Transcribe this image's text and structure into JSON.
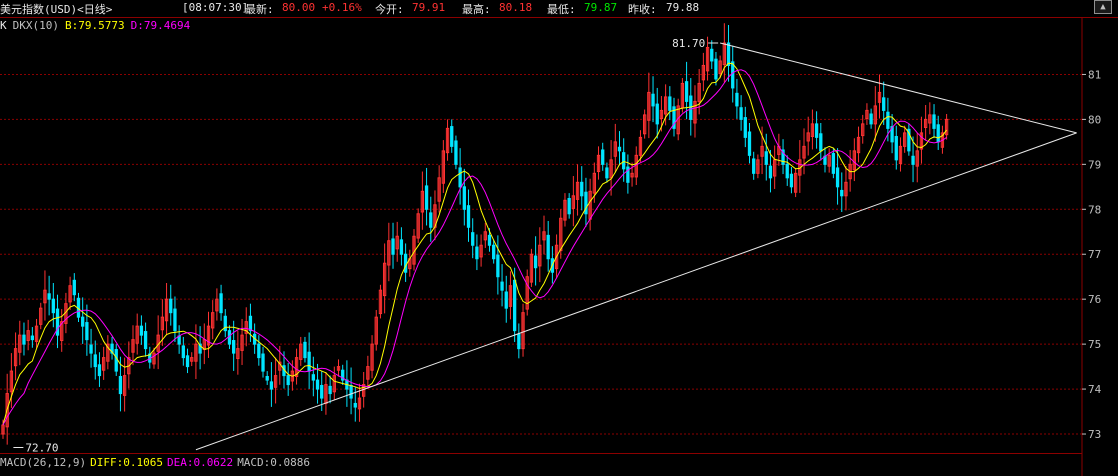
{
  "header": {
    "instrument": "美元指数(USD)<日线>",
    "time": "[08:07:30]",
    "last_label": "最新:",
    "last_value": "80.00",
    "change": "+0.16%",
    "open_label": "今开:",
    "open_value": "79.91",
    "high_label": "最高:",
    "high_value": "80.18",
    "low_label": "最低:",
    "low_value": "79.87",
    "prev_label": "昨收:",
    "prev_value": "79.88"
  },
  "indicator": {
    "k_label": "K",
    "name": "DKX(10)",
    "b_text": "B:79.5773",
    "d_text": "D:79.4694"
  },
  "macd": {
    "name": "MACD(26,12,9)",
    "diff": "DIFF:0.1065",
    "dea": "DEA:0.0622",
    "macd": "MACD:0.0886"
  },
  "colors": {
    "up": "#ff3232",
    "down": "#00e5ff",
    "b_line": "#ffff00",
    "d_line": "#ff00ff",
    "grid": "#8b0000",
    "trend": "#e8e8e8"
  },
  "chart_data": {
    "type": "candlestick",
    "ylim": [
      72.6,
      81.9
    ],
    "y_ticks": [
      73,
      74,
      75,
      76,
      77,
      78,
      79,
      80,
      81
    ],
    "annotations": [
      {
        "label": "81.70",
        "value": 81.7,
        "bar": 171
      },
      {
        "label": "72.70",
        "value": 72.7,
        "bar": 2
      }
    ],
    "trendlines": [
      {
        "name": "upper",
        "from": {
          "bar": 171,
          "value": 81.7
        },
        "to": {
          "bar": 256,
          "value": 79.7
        }
      },
      {
        "name": "lower",
        "from": {
          "bar": 46,
          "value": 72.65
        },
        "to": {
          "bar": 256,
          "value": 79.7
        }
      }
    ],
    "close": [
      73.2,
      73.9,
      74.4,
      74.9,
      75.2,
      75.0,
      75.3,
      75.1,
      75.4,
      75.8,
      76.2,
      76.0,
      75.7,
      75.2,
      75.5,
      75.9,
      76.3,
      76.1,
      75.6,
      75.4,
      75.1,
      74.8,
      74.5,
      74.3,
      74.7,
      75.0,
      74.8,
      74.4,
      73.9,
      74.3,
      74.7,
      75.1,
      75.4,
      75.2,
      74.9,
      74.6,
      74.8,
      75.2,
      75.6,
      76.0,
      75.7,
      75.3,
      75.0,
      74.7,
      74.5,
      74.7,
      75.0,
      74.8,
      75.1,
      75.4,
      75.7,
      76.0,
      75.7,
      75.3,
      75.0,
      74.8,
      74.9,
      75.2,
      75.5,
      75.3,
      75.0,
      74.7,
      74.4,
      74.2,
      74.0,
      74.3,
      74.6,
      74.3,
      74.1,
      74.4,
      74.7,
      75.0,
      74.7,
      74.4,
      74.2,
      74.0,
      73.8,
      74.1,
      73.9,
      74.3,
      74.5,
      74.2,
      74.0,
      73.8,
      73.6,
      73.8,
      74.1,
      74.5,
      75.0,
      75.6,
      76.2,
      76.8,
      77.3,
      77.0,
      77.4,
      77.0,
      76.6,
      76.9,
      77.4,
      77.9,
      78.4,
      78.0,
      77.6,
      78.1,
      78.7,
      79.3,
      79.8,
      79.4,
      79.0,
      78.5,
      78.0,
      77.6,
      77.2,
      76.9,
      77.2,
      77.5,
      77.2,
      76.9,
      76.5,
      76.2,
      75.8,
      76.3,
      75.3,
      74.9,
      75.7,
      76.5,
      77.0,
      76.7,
      77.2,
      77.5,
      76.9,
      76.6,
      77.2,
      77.8,
      78.2,
      77.9,
      78.3,
      78.6,
      78.3,
      77.9,
      78.4,
      78.8,
      79.2,
      79.0,
      78.7,
      79.1,
      79.5,
      79.3,
      78.9,
      78.6,
      78.8,
      79.2,
      79.6,
      80.1,
      80.6,
      80.3,
      79.9,
      80.2,
      80.5,
      80.2,
      79.8,
      80.3,
      80.8,
      80.4,
      80.0,
      80.4,
      80.8,
      81.2,
      81.6,
      81.3,
      80.9,
      81.3,
      81.7,
      81.2,
      80.7,
      80.3,
      80.0,
      79.6,
      79.2,
      78.8,
      79.1,
      79.4,
      79.0,
      78.7,
      79.1,
      79.4,
      79.0,
      78.7,
      78.5,
      78.8,
      79.1,
      79.4,
      79.7,
      79.9,
      79.6,
      79.3,
      79.0,
      79.2,
      78.8,
      78.5,
      78.3,
      78.6,
      79.0,
      79.3,
      79.6,
      79.9,
      80.2,
      79.9,
      80.3,
      80.6,
      80.2,
      79.8,
      79.5,
      79.1,
      79.4,
      79.7,
      79.3,
      79.0,
      79.3,
      79.7,
      80.0,
      80.1,
      79.8,
      79.5,
      79.7,
      80.0
    ]
  }
}
